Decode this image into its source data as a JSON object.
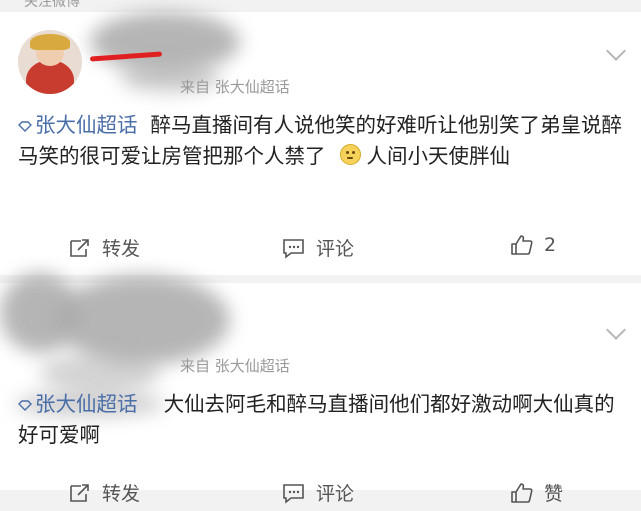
{
  "top_strip": {
    "text": "关注微博"
  },
  "posts": [
    {
      "source": "来自 张大仙超话",
      "tag": "张大仙超话",
      "text_part1": "醉马直播间有人说他笑的好难听让他别笑了弟皇说醉马笑的很可爱让房管把那个人禁了",
      "text_part2": "人间小天使胖仙",
      "repost_label": "转发",
      "comment_label": "评论",
      "like_count": "2"
    },
    {
      "source": "来自 张大仙超话",
      "tag": "张大仙超话",
      "text_part1": "大仙去阿毛和醉马直播间他们都好激动啊大仙真的好可爱啊",
      "repost_label": "转发",
      "comment_label": "评论",
      "like_label": "赞"
    }
  ],
  "icons": {
    "tag_icon": "diamond-icon",
    "emoji": "smile-emoji-icon",
    "repost": "repost-icon",
    "comment": "comment-icon",
    "like": "thumbs-up-icon",
    "menu": "chevron-down-icon"
  },
  "colors": {
    "tag_blue": "#4a6ea8",
    "background": "#f2f2f2",
    "card": "#ffffff",
    "redaction_red": "#e02020"
  }
}
